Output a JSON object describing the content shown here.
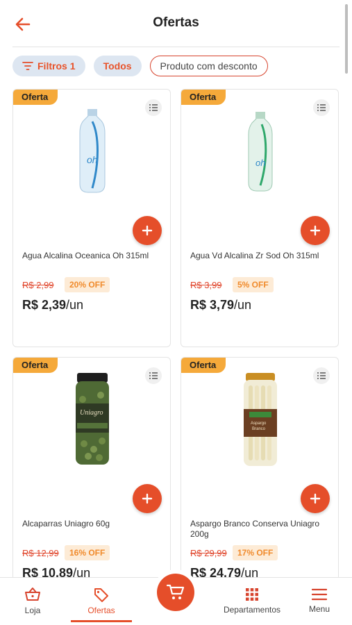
{
  "header": {
    "title": "Ofertas"
  },
  "filters": {
    "filtros_label": "Filtros",
    "filtros_count": "1",
    "todos_label": "Todos",
    "desconto_label": "Produto com desconto"
  },
  "products": [
    {
      "badge": "Oferta",
      "name": "Agua Alcalina Oceanica Oh 315ml",
      "old_price": "R$ 2,99",
      "discount": "20% OFF",
      "price": "R$ 2,39",
      "unit": "/un"
    },
    {
      "badge": "Oferta",
      "name": "Agua Vd Alcalina Zr Sod Oh 315ml",
      "old_price": "R$ 3,99",
      "discount": "5% OFF",
      "price": "R$ 3,79",
      "unit": "/un"
    },
    {
      "badge": "Oferta",
      "name": "Alcaparras Uniagro 60g",
      "old_price": "R$ 12,99",
      "discount": "16% OFF",
      "price": "R$ 10,89",
      "unit": "/un"
    },
    {
      "badge": "Oferta",
      "name": "Aspargo Branco Conserva Uniagro 200g",
      "old_price": "R$ 29,99",
      "discount": "17% OFF",
      "price": "R$ 24,79",
      "unit": "/un"
    }
  ],
  "nav": {
    "loja": "Loja",
    "ofertas": "Ofertas",
    "departamentos": "Departamentos",
    "menu": "Menu"
  },
  "colors": {
    "accent": "#e54e2a",
    "badge": "#f5a93a",
    "chip_bg": "#dde6f1"
  }
}
